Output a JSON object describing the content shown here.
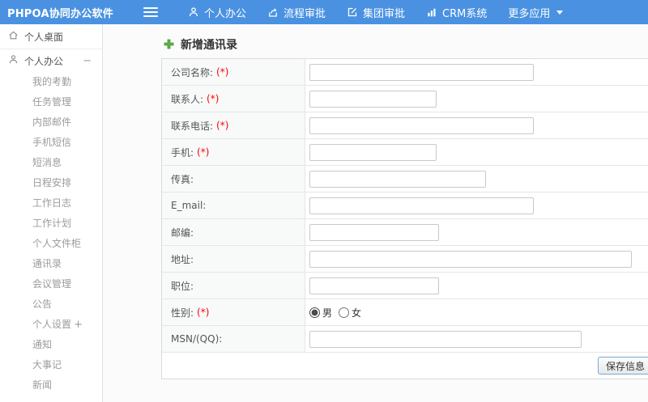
{
  "app": {
    "logo": "PHPOA协同办公软件"
  },
  "topnav": {
    "menu_icon": "hamburger-icon",
    "items": [
      {
        "label": "个人办公",
        "icon": "user-icon"
      },
      {
        "label": "流程审批",
        "icon": "approval-flow-icon"
      },
      {
        "label": "集团审批",
        "icon": "edit-square-icon"
      },
      {
        "label": "CRM系统",
        "icon": "bar-chart-icon"
      },
      {
        "label": "更多应用",
        "icon": "caret-down-icon"
      }
    ]
  },
  "sidebar": {
    "desktop_label": "个人桌面",
    "section": {
      "label": "个人办公",
      "collapse_glyph": "−"
    },
    "settings_expand_glyph": "+",
    "items": [
      "我的考勤",
      "任务管理",
      "内部邮件",
      "手机短信",
      "短消息",
      "日程安排",
      "工作日志",
      "工作计划",
      "个人文件柜",
      "通讯录",
      "会议管理",
      "公告",
      "个人设置",
      "通知",
      "大事记",
      "新闻"
    ]
  },
  "main": {
    "title": "新增通讯录",
    "title_icon": "plus-icon"
  },
  "form": {
    "rows": [
      {
        "label": "公司名称:",
        "required": "(*)",
        "value": ""
      },
      {
        "label": "联系人:",
        "required": "(*)",
        "value": ""
      },
      {
        "label": "联系电话:",
        "required": "(*)",
        "value": ""
      },
      {
        "label": "手机:",
        "required": "(*)",
        "value": ""
      },
      {
        "label": "传真:",
        "required": "",
        "value": ""
      },
      {
        "label": "E_mail:",
        "required": "",
        "value": ""
      },
      {
        "label": "邮编:",
        "required": "",
        "value": ""
      },
      {
        "label": "地址:",
        "required": "",
        "value": ""
      },
      {
        "label": "职位:",
        "required": "",
        "value": ""
      },
      {
        "label": "性别:",
        "required": "(*)",
        "options": [
          {
            "label": "男",
            "checked": true
          },
          {
            "label": "女",
            "checked": false
          }
        ]
      },
      {
        "label": "MSN/(QQ):",
        "required": "",
        "value": ""
      }
    ],
    "save_label": "保存信息"
  },
  "colors": {
    "topbar_blue": "#4a92e1",
    "required_red": "#ff0000",
    "plus_green": "#5fb13d",
    "save_button_border": "#7ba7d7"
  }
}
